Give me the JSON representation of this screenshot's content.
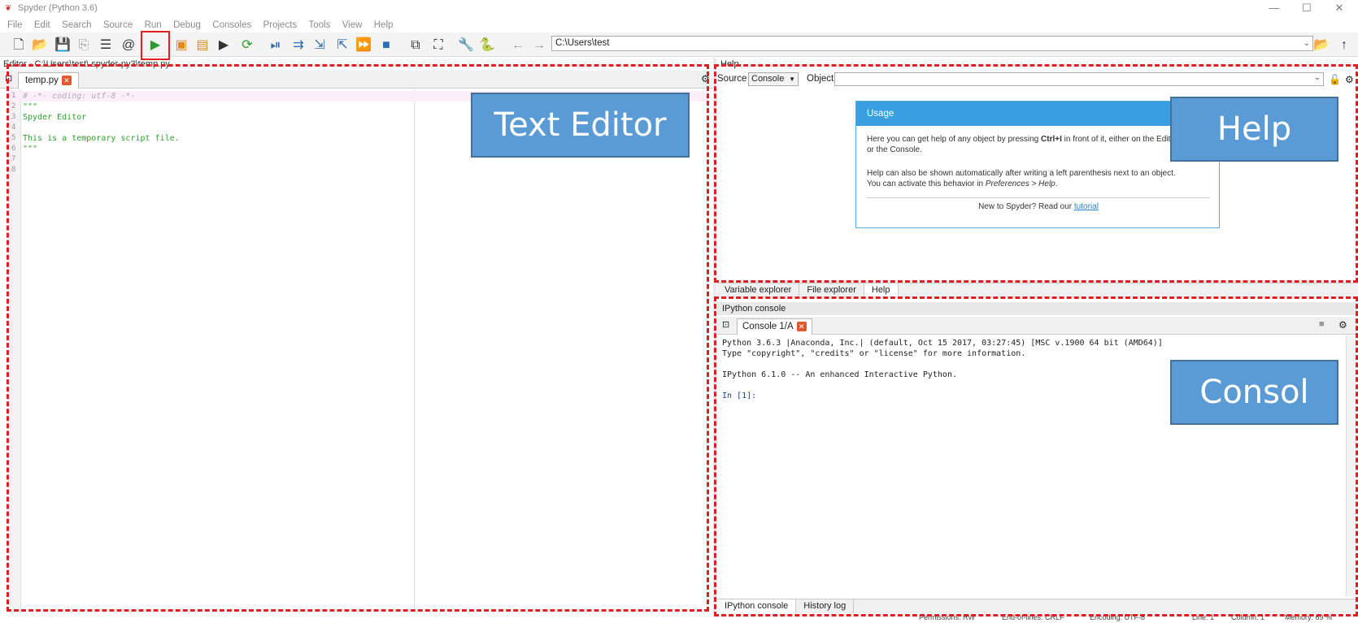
{
  "window": {
    "title": "Spyder (Python 3.6)",
    "controls": [
      "—",
      "☐",
      "✕"
    ]
  },
  "menu": [
    "File",
    "Edit",
    "Search",
    "Source",
    "Run",
    "Debug",
    "Consoles",
    "Projects",
    "Tools",
    "View",
    "Help"
  ],
  "toolbar": {
    "cwd_path": "C:\\Users\\test"
  },
  "editor": {
    "header": "Editor - C:\\Users\\test\\.spyder-py3\\temp.py",
    "tab_label": "temp.py",
    "lines": [
      {
        "n": "1",
        "text": "# -*- coding: utf-8 -*-",
        "kind": "comment"
      },
      {
        "n": "2",
        "text": "\"\"\"",
        "kind": "string"
      },
      {
        "n": "3",
        "text": "Spyder Editor",
        "kind": "string"
      },
      {
        "n": "4",
        "text": "",
        "kind": "string"
      },
      {
        "n": "5",
        "text": "This is a temporary script file.",
        "kind": "string"
      },
      {
        "n": "6",
        "text": "\"\"\"",
        "kind": "string"
      },
      {
        "n": "7",
        "text": "",
        "kind": "plain"
      },
      {
        "n": "8",
        "text": "",
        "kind": "plain"
      }
    ]
  },
  "help": {
    "header": "Help",
    "source_label": "Source",
    "source_value": "Console",
    "object_label": "Object",
    "usage_title": "Usage",
    "usage_p1_a": "Here you can get help of any object by pressing ",
    "usage_p1_b": "Ctrl+I",
    "usage_p1_c": " in front of it, either on the Editor",
    "usage_p1_d": "or the Console.",
    "usage_p2_a": "Help can also be shown automatically after writing a left parenthesis next to an object.",
    "usage_p2_b": "You can activate this behavior in ",
    "usage_p2_c": "Preferences > Help",
    "usage_p2_d": ".",
    "usage_foot": "New to Spyder? Read our ",
    "usage_link": "tutorial",
    "tabs": [
      "Variable explorer",
      "File explorer",
      "Help"
    ]
  },
  "console": {
    "header": "IPython console",
    "tab_label": "Console 1/A",
    "lines": [
      "Python 3.6.3 |Anaconda, Inc.| (default, Oct 15 2017, 03:27:45) [MSC v.1900 64 bit (AMD64)]",
      "Type \"copyright\", \"credits\" or \"license\" for more information.",
      "",
      "IPython 6.1.0 -- An enhanced Interactive Python.",
      ""
    ],
    "prompt": "In [1]:",
    "tabs": [
      "IPython console",
      "History log"
    ]
  },
  "statusbar": {
    "permissions": "Permissions: RW",
    "eol": "End-of-lines: CRLF",
    "encoding": "Encoding: UTF-8",
    "line": "Line: 1",
    "column": "Column: 1",
    "memory": "Memory: 69 %"
  },
  "overlays": {
    "editor": "Text Editor",
    "help": "Help",
    "console": "Consol"
  },
  "colors": {
    "highlight": "#e02020",
    "overlay_fill": "#5b9bd5",
    "usage_header": "#3a9fe0"
  }
}
